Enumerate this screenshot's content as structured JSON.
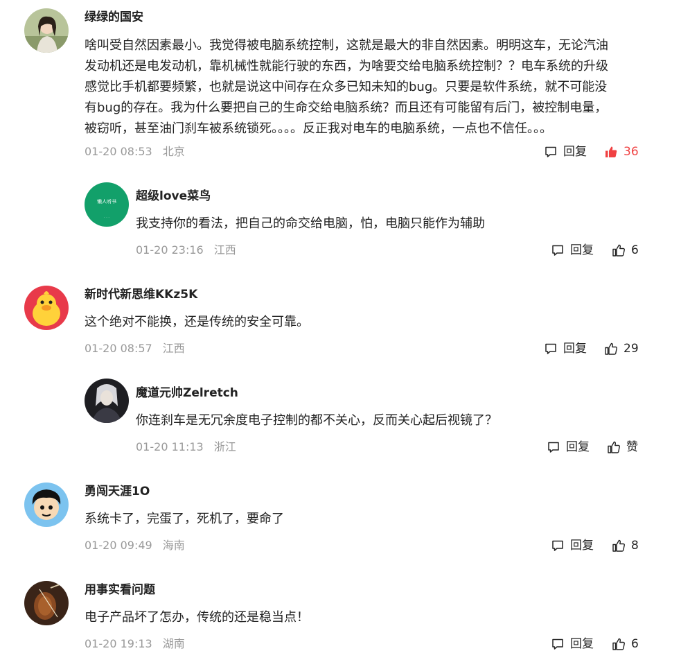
{
  "reply_label": "回复",
  "like_color": "#f04142",
  "comments": [
    {
      "name": "绿绿的国安",
      "avatar": "girl-portrait-avatar",
      "lines": [
        "啥叫受自然因素最小。我觉得被电脑系统控制，这就是最大的非自然因素。明明这车，无论汽油",
        "发动机还是电发动机，靠机械性就能行驶的东西，为啥要交给电脑系统控制？？电车系统的升级",
        "感觉比手机都要频繁，也就是说这中间存在众多已知未知的bug。只要是软件系统，就不可能没",
        "有bug的存在。我为什么要把自己的生命交给电脑系统？而且还有可能留有后门，被控制电量，",
        "被窃听，甚至油门刹车被系统锁死。。。。反正我对电车的电脑系统，一点也不信任。。。"
      ],
      "time": "01-20 08:53",
      "location": "北京",
      "likes": "36",
      "liked": true
    },
    {
      "name": "超级love菜鸟",
      "avatar": "green-badge-avatar",
      "avatar_text": "懒人听书",
      "lines": [
        "我支持你的看法，把自己的命交给电脑，怕，电脑只能作为辅助"
      ],
      "time": "01-20 23:16",
      "location": "江西",
      "likes": "6",
      "liked": false
    },
    {
      "name": "新时代新思维KKz5K",
      "avatar": "yellow-duck-avatar",
      "lines": [
        "这个绝对不能换，还是传统的安全可靠。"
      ],
      "time": "01-20 08:57",
      "location": "江西",
      "likes": "29",
      "liked": false
    },
    {
      "name": "魔道元帅Zelretch",
      "avatar": "dark-anime-avatar",
      "lines": [
        "你连刹车是无冗余度电子控制的都不关心，反而关心起后视镜了？"
      ],
      "time": "01-20 11:13",
      "location": "浙江",
      "likes": "赞",
      "liked": false
    },
    {
      "name": "勇闯天涯1O",
      "avatar": "cartoon-boy-avatar",
      "lines": [
        "系统卡了，完蛋了，死机了，要命了"
      ],
      "time": "01-20 09:49",
      "location": "海南",
      "likes": "8",
      "liked": false
    },
    {
      "name": "用事实看问题",
      "avatar": "violin-avatar",
      "lines": [
        "电子产品坏了怎办，传统的还是稳当点！"
      ],
      "time": "01-20 19:13",
      "location": "湖南",
      "likes": "6",
      "liked": false
    }
  ]
}
